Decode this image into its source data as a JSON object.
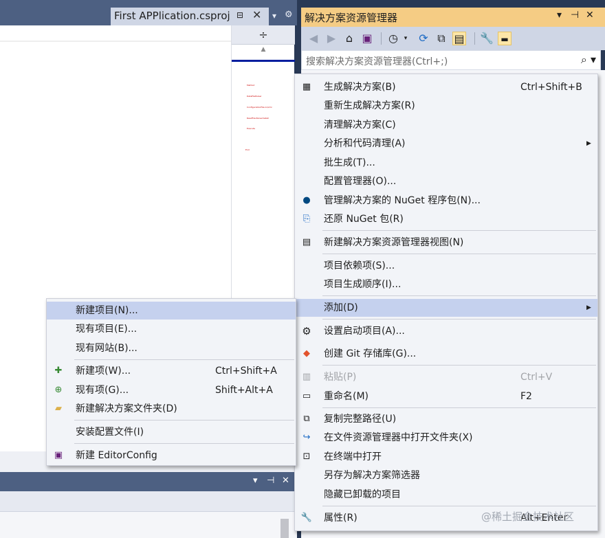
{
  "editor": {
    "tab_title": "First APPlication.csproj",
    "tab_pin": "⊟",
    "tab_close": "✕",
    "tab_dropdown": "▾",
    "tab_settings": "⚙",
    "split_glyph": "÷",
    "scroll_up": "▲",
    "minimap_lines": [
      "Method",
      "DataFileParser",
      "ConfigurationFile.ini/xml",
      "ReadFile.ParserInstall",
      "Execute",
      "End"
    ]
  },
  "bottom_panel": {
    "ctl_dropdown": "▾",
    "ctl_pin": "⊣",
    "ctl_close": "✕"
  },
  "solution_explorer": {
    "title": "解决方案资源管理器",
    "ctl_dropdown": "▾",
    "ctl_pin": "⊣",
    "ctl_close": "✕",
    "search_placeholder": "搜索解决方案资源管理器(Ctrl+;)",
    "search_icon": "search-icon",
    "toolbar_icons": [
      "back-icon",
      "forward-icon",
      "home-icon",
      "vs-switch-icon",
      "history-icon",
      "sync-icon",
      "collapse-all-icon",
      "show-all-files-icon",
      "properties-wrench-icon",
      "preview-icon"
    ]
  },
  "context_menu": {
    "items": [
      {
        "label": "生成解决方案(B)",
        "shortcut": "Ctrl+Shift+B",
        "icon": "build-icon"
      },
      {
        "label": "重新生成解决方案(R)",
        "shortcut": ""
      },
      {
        "label": "清理解决方案(C)",
        "shortcut": ""
      },
      {
        "label": "分析和代码清理(A)",
        "shortcut": "",
        "submenu": true
      },
      {
        "label": "批生成(T)...",
        "shortcut": ""
      },
      {
        "label": "配置管理器(O)...",
        "shortcut": ""
      },
      {
        "label": "管理解决方案的 NuGet 程序包(N)...",
        "shortcut": "",
        "icon": "nuget-icon"
      },
      {
        "label": "还原 NuGet 包(R)",
        "shortcut": "",
        "icon": "restore-icon"
      },
      {
        "label": "新建解决方案资源管理器视图(N)",
        "shortcut": "",
        "icon": "new-view-icon"
      },
      {
        "label": "项目依赖项(S)...",
        "shortcut": ""
      },
      {
        "label": "项目生成顺序(I)...",
        "shortcut": ""
      },
      {
        "label": "添加(D)",
        "shortcut": "",
        "submenu": true
      },
      {
        "label": "设置启动项目(A)...",
        "shortcut": "",
        "icon": "gear-icon"
      },
      {
        "label": "创建 Git 存储库(G)...",
        "shortcut": "",
        "icon": "git-icon"
      },
      {
        "label": "粘贴(P)",
        "shortcut": "Ctrl+V",
        "icon": "paste-icon",
        "disabled": true
      },
      {
        "label": "重命名(M)",
        "shortcut": "F2",
        "icon": "rename-icon"
      },
      {
        "label": "复制完整路径(U)",
        "shortcut": "",
        "icon": "copy-path-icon"
      },
      {
        "label": "在文件资源管理器中打开文件夹(X)",
        "shortcut": "",
        "icon": "open-folder-icon"
      },
      {
        "label": "在终端中打开",
        "shortcut": "",
        "icon": "terminal-icon"
      },
      {
        "label": "另存为解决方案筛选器",
        "shortcut": ""
      },
      {
        "label": "隐藏已卸载的项目",
        "shortcut": ""
      },
      {
        "label": "属性(R)",
        "shortcut": "Alt+Enter",
        "icon": "wrench-icon"
      }
    ]
  },
  "add_submenu": {
    "items": [
      {
        "label": "新建项目(N)...",
        "shortcut": ""
      },
      {
        "label": "现有项目(E)...",
        "shortcut": ""
      },
      {
        "label": "现有网站(B)...",
        "shortcut": ""
      },
      {
        "label": "新建项(W)...",
        "shortcut": "Ctrl+Shift+A",
        "icon": "new-item-icon"
      },
      {
        "label": "现有项(G)...",
        "shortcut": "Shift+Alt+A",
        "icon": "existing-item-icon"
      },
      {
        "label": "新建解决方案文件夹(D)",
        "shortcut": "",
        "icon": "new-folder-icon"
      },
      {
        "label": "安装配置文件(I)",
        "shortcut": ""
      },
      {
        "label": "新建 EditorConfig",
        "shortcut": "",
        "icon": "editorconfig-icon"
      }
    ]
  },
  "watermark": "@稀土掘金技术社区"
}
